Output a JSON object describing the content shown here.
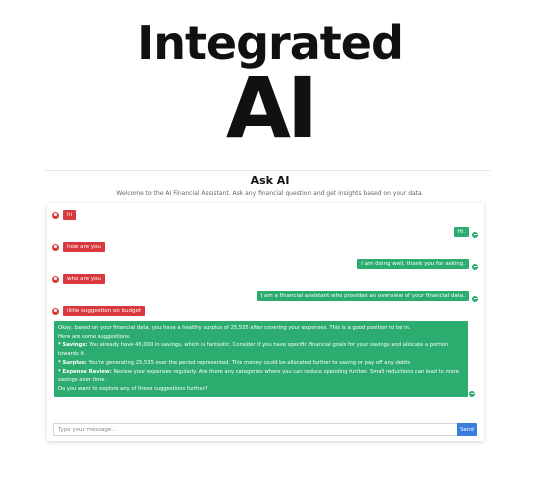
{
  "hero": {
    "line1": "Integrated",
    "line2": "AI"
  },
  "panel": {
    "title": "Ask AI",
    "subtitle": "Welcome to the AI Financial Assistant. Ask any financial question and get insights based on your data."
  },
  "messages": {
    "m1": "hi",
    "m2": "Hi.",
    "m3": "how are you",
    "m4": "I am doing well, thank you for asking.",
    "m5": "who are you",
    "m6": "I am a financial assistant who provides an overview of your financial data.",
    "m7": "little suggestion on budget"
  },
  "reply": {
    "intro": "Okay, based on your financial data, you have a healthy surplus of 25,535 after covering your expenses. This is a good position to be in.",
    "lead": "Here are some suggestions:",
    "s1_label": "* Savings:",
    "s1_text": " You already have 45,000 in savings, which is fantastic. Consider if you have specific financial goals for your savings and allocate a portion towards it.",
    "s2_label": "* Surplus:",
    "s2_text": " You're generating 25,535 over the period represented. This money could be allocated further to saving or pay off any debts",
    "s3_label": "* Expense Review:",
    "s3_text": " Review your expenses regularly. Are there any categories where you can reduce spending further. Small reductions can lead to more savings over time.",
    "outro": "Do you want to explore any of these suggestions further?"
  },
  "input": {
    "placeholder": "Type your message...",
    "send_label": "Send"
  },
  "colors": {
    "user_bubble": "#d9393c",
    "ai_bubble": "#2dac6f",
    "send_button": "#3b7ddd"
  },
  "icons": {
    "user": "user-avatar-icon",
    "ai": "chat-bot-icon"
  }
}
